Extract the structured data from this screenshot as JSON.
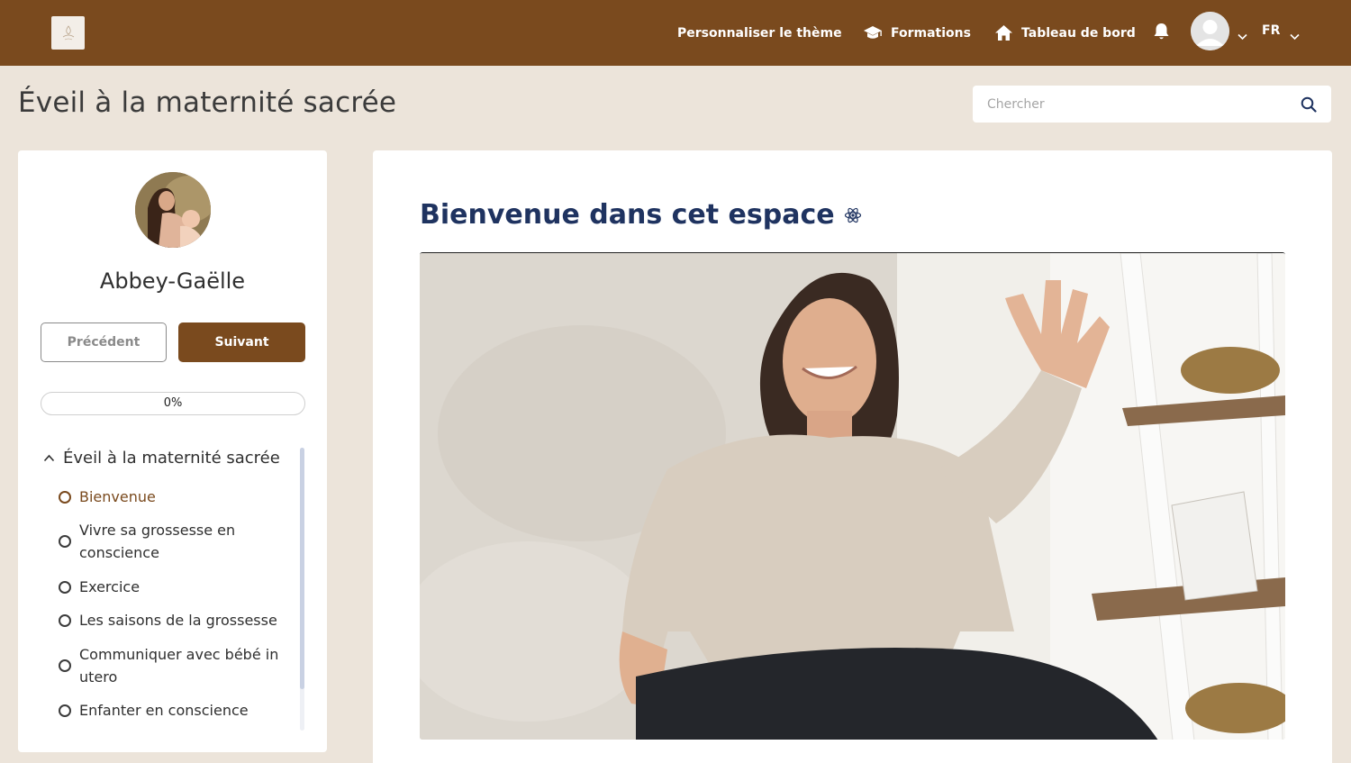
{
  "topbar": {
    "nav_theme": "Personnaliser le thème",
    "nav_formations": "Formations",
    "nav_dashboard": "Tableau de bord",
    "language": "FR",
    "colors": {
      "bar": "#7a4a1e",
      "text": "#ffffff"
    }
  },
  "page": {
    "title": "Éveil à la maternité sacrée",
    "search_placeholder": "Chercher"
  },
  "sidebar": {
    "author_name": "Abbey-Gaëlle",
    "prev_label": "Précédent",
    "next_label": "Suivant",
    "progress_text": "0%",
    "progress_value": 0,
    "module_title": "Éveil à la maternité sacrée",
    "lessons": [
      {
        "label": "Bienvenue",
        "active": true
      },
      {
        "label": "Vivre sa grossesse en conscience",
        "active": false
      },
      {
        "label": "Exercice",
        "active": false
      },
      {
        "label": "Les saisons de la grossesse",
        "active": false
      },
      {
        "label": "Communiquer avec bébé in utero",
        "active": false
      },
      {
        "label": "Enfanter en conscience",
        "active": false
      }
    ]
  },
  "main": {
    "title": "Bienvenue dans cet espace",
    "title_icon": "atom-icon"
  },
  "colors": {
    "accent": "#7a4a1e",
    "heading": "#1f3360",
    "background": "#ece4da"
  }
}
